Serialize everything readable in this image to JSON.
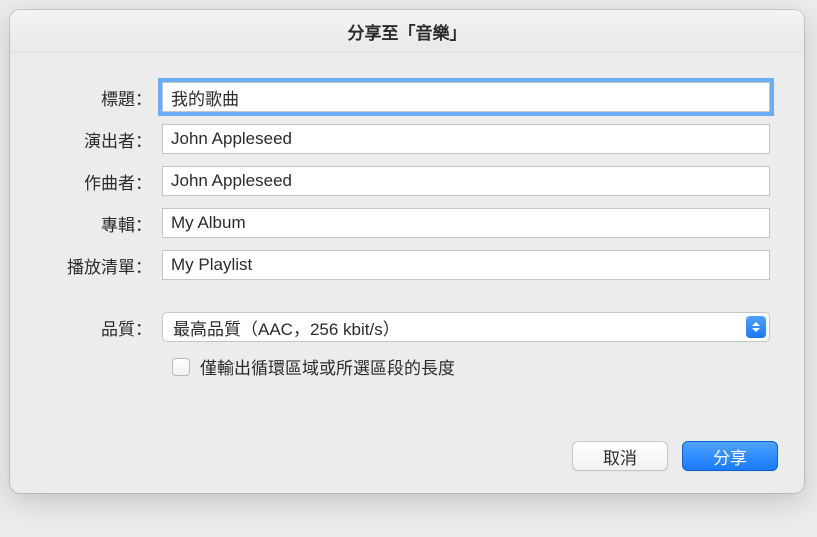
{
  "dialog": {
    "title": "分享至「音樂」",
    "fields": {
      "title_label": "標題：",
      "title_value": "我的歌曲",
      "artist_label": "演出者：",
      "artist_value": "John Appleseed",
      "composer_label": "作曲者：",
      "composer_value": "John Appleseed",
      "album_label": "專輯：",
      "album_value": "My Album",
      "playlist_label": "播放清單：",
      "playlist_value": "My Playlist",
      "quality_label": "品質：",
      "quality_value": "最高品質（AAC，256 kbit/s）",
      "cycle_checkbox_label": "僅輸出循環區域或所選區段的長度"
    },
    "buttons": {
      "cancel": "取消",
      "share": "分享"
    }
  }
}
